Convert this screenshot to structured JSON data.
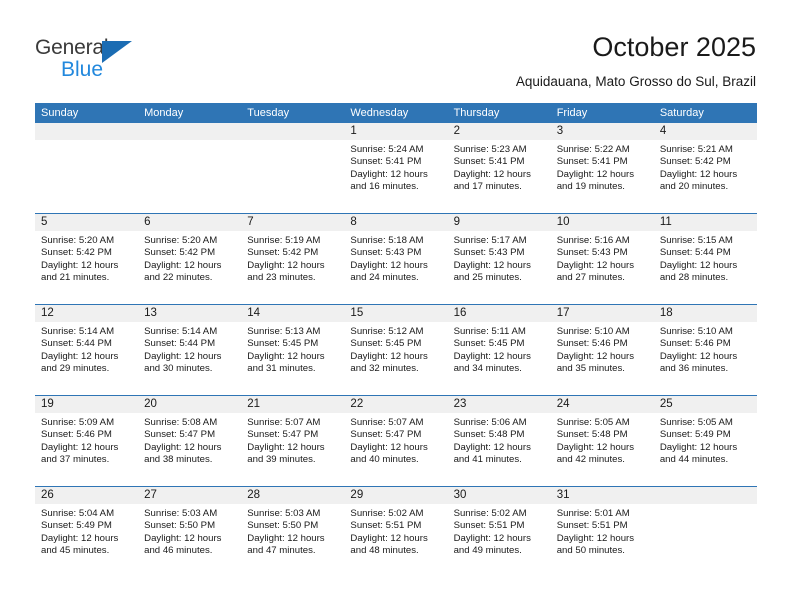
{
  "logo": {
    "primary_text": "General",
    "secondary_text": "Blue",
    "primary_color": "#3a3a3a",
    "secondary_color": "#2288dd",
    "triangle_color": "#1b6cb3"
  },
  "header": {
    "month_title": "October 2025",
    "location": "Aquidauana, Mato Grosso do Sul, Brazil"
  },
  "theme": {
    "header_blue": "#2f75b5",
    "day_band_gray": "#f0f0f0",
    "text_color": "#1a1a1a"
  },
  "calendar": {
    "weekdays": [
      "Sunday",
      "Monday",
      "Tuesday",
      "Wednesday",
      "Thursday",
      "Friday",
      "Saturday"
    ],
    "labels": {
      "sunrise": "Sunrise:",
      "sunset": "Sunset:",
      "daylight": "Daylight:"
    },
    "weeks": [
      [
        {
          "day": "",
          "empty": true,
          "sunrise": "",
          "sunset": "",
          "daylight_line1": "",
          "daylight_line2": ""
        },
        {
          "day": "",
          "empty": true,
          "sunrise": "",
          "sunset": "",
          "daylight_line1": "",
          "daylight_line2": ""
        },
        {
          "day": "",
          "empty": true,
          "sunrise": "",
          "sunset": "",
          "daylight_line1": "",
          "daylight_line2": ""
        },
        {
          "day": "1",
          "empty": false,
          "sunrise": "Sunrise: 5:24 AM",
          "sunset": "Sunset: 5:41 PM",
          "daylight_line1": "Daylight: 12 hours",
          "daylight_line2": "and 16 minutes."
        },
        {
          "day": "2",
          "empty": false,
          "sunrise": "Sunrise: 5:23 AM",
          "sunset": "Sunset: 5:41 PM",
          "daylight_line1": "Daylight: 12 hours",
          "daylight_line2": "and 17 minutes."
        },
        {
          "day": "3",
          "empty": false,
          "sunrise": "Sunrise: 5:22 AM",
          "sunset": "Sunset: 5:41 PM",
          "daylight_line1": "Daylight: 12 hours",
          "daylight_line2": "and 19 minutes."
        },
        {
          "day": "4",
          "empty": false,
          "sunrise": "Sunrise: 5:21 AM",
          "sunset": "Sunset: 5:42 PM",
          "daylight_line1": "Daylight: 12 hours",
          "daylight_line2": "and 20 minutes."
        }
      ],
      [
        {
          "day": "5",
          "empty": false,
          "sunrise": "Sunrise: 5:20 AM",
          "sunset": "Sunset: 5:42 PM",
          "daylight_line1": "Daylight: 12 hours",
          "daylight_line2": "and 21 minutes."
        },
        {
          "day": "6",
          "empty": false,
          "sunrise": "Sunrise: 5:20 AM",
          "sunset": "Sunset: 5:42 PM",
          "daylight_line1": "Daylight: 12 hours",
          "daylight_line2": "and 22 minutes."
        },
        {
          "day": "7",
          "empty": false,
          "sunrise": "Sunrise: 5:19 AM",
          "sunset": "Sunset: 5:42 PM",
          "daylight_line1": "Daylight: 12 hours",
          "daylight_line2": "and 23 minutes."
        },
        {
          "day": "8",
          "empty": false,
          "sunrise": "Sunrise: 5:18 AM",
          "sunset": "Sunset: 5:43 PM",
          "daylight_line1": "Daylight: 12 hours",
          "daylight_line2": "and 24 minutes."
        },
        {
          "day": "9",
          "empty": false,
          "sunrise": "Sunrise: 5:17 AM",
          "sunset": "Sunset: 5:43 PM",
          "daylight_line1": "Daylight: 12 hours",
          "daylight_line2": "and 25 minutes."
        },
        {
          "day": "10",
          "empty": false,
          "sunrise": "Sunrise: 5:16 AM",
          "sunset": "Sunset: 5:43 PM",
          "daylight_line1": "Daylight: 12 hours",
          "daylight_line2": "and 27 minutes."
        },
        {
          "day": "11",
          "empty": false,
          "sunrise": "Sunrise: 5:15 AM",
          "sunset": "Sunset: 5:44 PM",
          "daylight_line1": "Daylight: 12 hours",
          "daylight_line2": "and 28 minutes."
        }
      ],
      [
        {
          "day": "12",
          "empty": false,
          "sunrise": "Sunrise: 5:14 AM",
          "sunset": "Sunset: 5:44 PM",
          "daylight_line1": "Daylight: 12 hours",
          "daylight_line2": "and 29 minutes."
        },
        {
          "day": "13",
          "empty": false,
          "sunrise": "Sunrise: 5:14 AM",
          "sunset": "Sunset: 5:44 PM",
          "daylight_line1": "Daylight: 12 hours",
          "daylight_line2": "and 30 minutes."
        },
        {
          "day": "14",
          "empty": false,
          "sunrise": "Sunrise: 5:13 AM",
          "sunset": "Sunset: 5:45 PM",
          "daylight_line1": "Daylight: 12 hours",
          "daylight_line2": "and 31 minutes."
        },
        {
          "day": "15",
          "empty": false,
          "sunrise": "Sunrise: 5:12 AM",
          "sunset": "Sunset: 5:45 PM",
          "daylight_line1": "Daylight: 12 hours",
          "daylight_line2": "and 32 minutes."
        },
        {
          "day": "16",
          "empty": false,
          "sunrise": "Sunrise: 5:11 AM",
          "sunset": "Sunset: 5:45 PM",
          "daylight_line1": "Daylight: 12 hours",
          "daylight_line2": "and 34 minutes."
        },
        {
          "day": "17",
          "empty": false,
          "sunrise": "Sunrise: 5:10 AM",
          "sunset": "Sunset: 5:46 PM",
          "daylight_line1": "Daylight: 12 hours",
          "daylight_line2": "and 35 minutes."
        },
        {
          "day": "18",
          "empty": false,
          "sunrise": "Sunrise: 5:10 AM",
          "sunset": "Sunset: 5:46 PM",
          "daylight_line1": "Daylight: 12 hours",
          "daylight_line2": "and 36 minutes."
        }
      ],
      [
        {
          "day": "19",
          "empty": false,
          "sunrise": "Sunrise: 5:09 AM",
          "sunset": "Sunset: 5:46 PM",
          "daylight_line1": "Daylight: 12 hours",
          "daylight_line2": "and 37 minutes."
        },
        {
          "day": "20",
          "empty": false,
          "sunrise": "Sunrise: 5:08 AM",
          "sunset": "Sunset: 5:47 PM",
          "daylight_line1": "Daylight: 12 hours",
          "daylight_line2": "and 38 minutes."
        },
        {
          "day": "21",
          "empty": false,
          "sunrise": "Sunrise: 5:07 AM",
          "sunset": "Sunset: 5:47 PM",
          "daylight_line1": "Daylight: 12 hours",
          "daylight_line2": "and 39 minutes."
        },
        {
          "day": "22",
          "empty": false,
          "sunrise": "Sunrise: 5:07 AM",
          "sunset": "Sunset: 5:47 PM",
          "daylight_line1": "Daylight: 12 hours",
          "daylight_line2": "and 40 minutes."
        },
        {
          "day": "23",
          "empty": false,
          "sunrise": "Sunrise: 5:06 AM",
          "sunset": "Sunset: 5:48 PM",
          "daylight_line1": "Daylight: 12 hours",
          "daylight_line2": "and 41 minutes."
        },
        {
          "day": "24",
          "empty": false,
          "sunrise": "Sunrise: 5:05 AM",
          "sunset": "Sunset: 5:48 PM",
          "daylight_line1": "Daylight: 12 hours",
          "daylight_line2": "and 42 minutes."
        },
        {
          "day": "25",
          "empty": false,
          "sunrise": "Sunrise: 5:05 AM",
          "sunset": "Sunset: 5:49 PM",
          "daylight_line1": "Daylight: 12 hours",
          "daylight_line2": "and 44 minutes."
        }
      ],
      [
        {
          "day": "26",
          "empty": false,
          "sunrise": "Sunrise: 5:04 AM",
          "sunset": "Sunset: 5:49 PM",
          "daylight_line1": "Daylight: 12 hours",
          "daylight_line2": "and 45 minutes."
        },
        {
          "day": "27",
          "empty": false,
          "sunrise": "Sunrise: 5:03 AM",
          "sunset": "Sunset: 5:50 PM",
          "daylight_line1": "Daylight: 12 hours",
          "daylight_line2": "and 46 minutes."
        },
        {
          "day": "28",
          "empty": false,
          "sunrise": "Sunrise: 5:03 AM",
          "sunset": "Sunset: 5:50 PM",
          "daylight_line1": "Daylight: 12 hours",
          "daylight_line2": "and 47 minutes."
        },
        {
          "day": "29",
          "empty": false,
          "sunrise": "Sunrise: 5:02 AM",
          "sunset": "Sunset: 5:51 PM",
          "daylight_line1": "Daylight: 12 hours",
          "daylight_line2": "and 48 minutes."
        },
        {
          "day": "30",
          "empty": false,
          "sunrise": "Sunrise: 5:02 AM",
          "sunset": "Sunset: 5:51 PM",
          "daylight_line1": "Daylight: 12 hours",
          "daylight_line2": "and 49 minutes."
        },
        {
          "day": "31",
          "empty": false,
          "sunrise": "Sunrise: 5:01 AM",
          "sunset": "Sunset: 5:51 PM",
          "daylight_line1": "Daylight: 12 hours",
          "daylight_line2": "and 50 minutes."
        },
        {
          "day": "",
          "empty": true,
          "sunrise": "",
          "sunset": "",
          "daylight_line1": "",
          "daylight_line2": ""
        }
      ]
    ]
  }
}
